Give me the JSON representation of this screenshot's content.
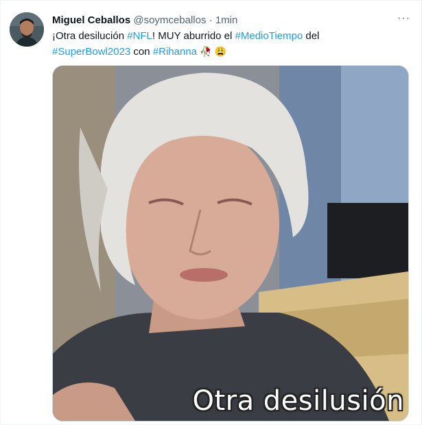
{
  "tweet": {
    "author": {
      "name": "Miguel Ceballos",
      "handle": "@soymceballos",
      "separator": "·",
      "time": "1min"
    },
    "more_label": "···",
    "text": {
      "p1": "¡Otra desilución ",
      "tag1": "#NFL",
      "p2": "! MUY aburrido el ",
      "tag2": "#MedioTiempo",
      "p3": " del",
      "tag3": "#SuperBowl2023",
      "p4": " con ",
      "tag4": "#Rihanna",
      "emoji1": "🥀",
      "emoji2": "😩"
    },
    "media": {
      "caption": "Otra desilusión"
    }
  }
}
